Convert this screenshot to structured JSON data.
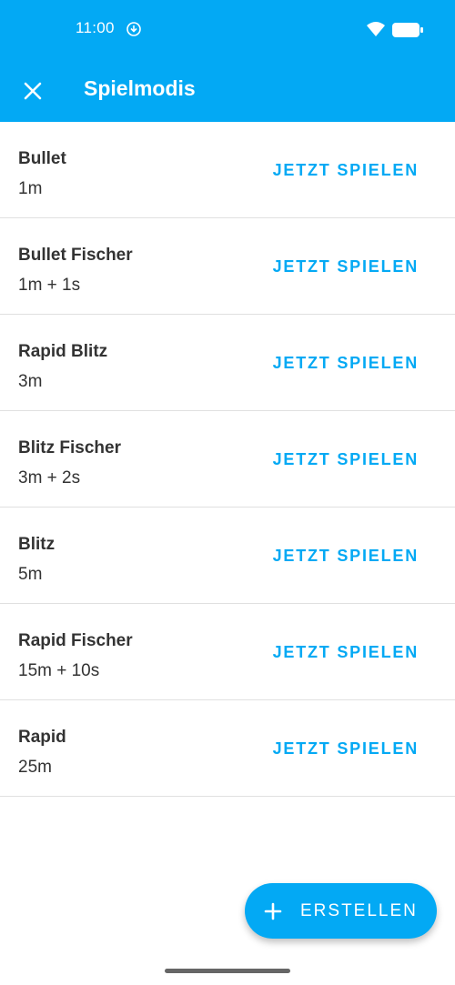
{
  "status_bar": {
    "time": "11:00"
  },
  "app_bar": {
    "title": "Spielmodis"
  },
  "modes": [
    {
      "name": "Bullet",
      "time": "1m",
      "action": "JETZT SPIELEN"
    },
    {
      "name": "Bullet Fischer",
      "time": "1m + 1s",
      "action": "JETZT SPIELEN"
    },
    {
      "name": "Rapid Blitz",
      "time": "3m",
      "action": "JETZT SPIELEN"
    },
    {
      "name": "Blitz Fischer",
      "time": "3m + 2s",
      "action": "JETZT SPIELEN"
    },
    {
      "name": "Blitz",
      "time": "5m",
      "action": "JETZT SPIELEN"
    },
    {
      "name": "Rapid Fischer",
      "time": "15m + 10s",
      "action": "JETZT SPIELEN"
    },
    {
      "name": "Rapid",
      "time": "25m",
      "action": "JETZT SPIELEN"
    }
  ],
  "fab": {
    "label": "ERSTELLEN",
    "icon": "plus-icon"
  },
  "colors": {
    "primary": "#03a9f4",
    "text": "#333333",
    "divider": "#e0e0e0"
  }
}
